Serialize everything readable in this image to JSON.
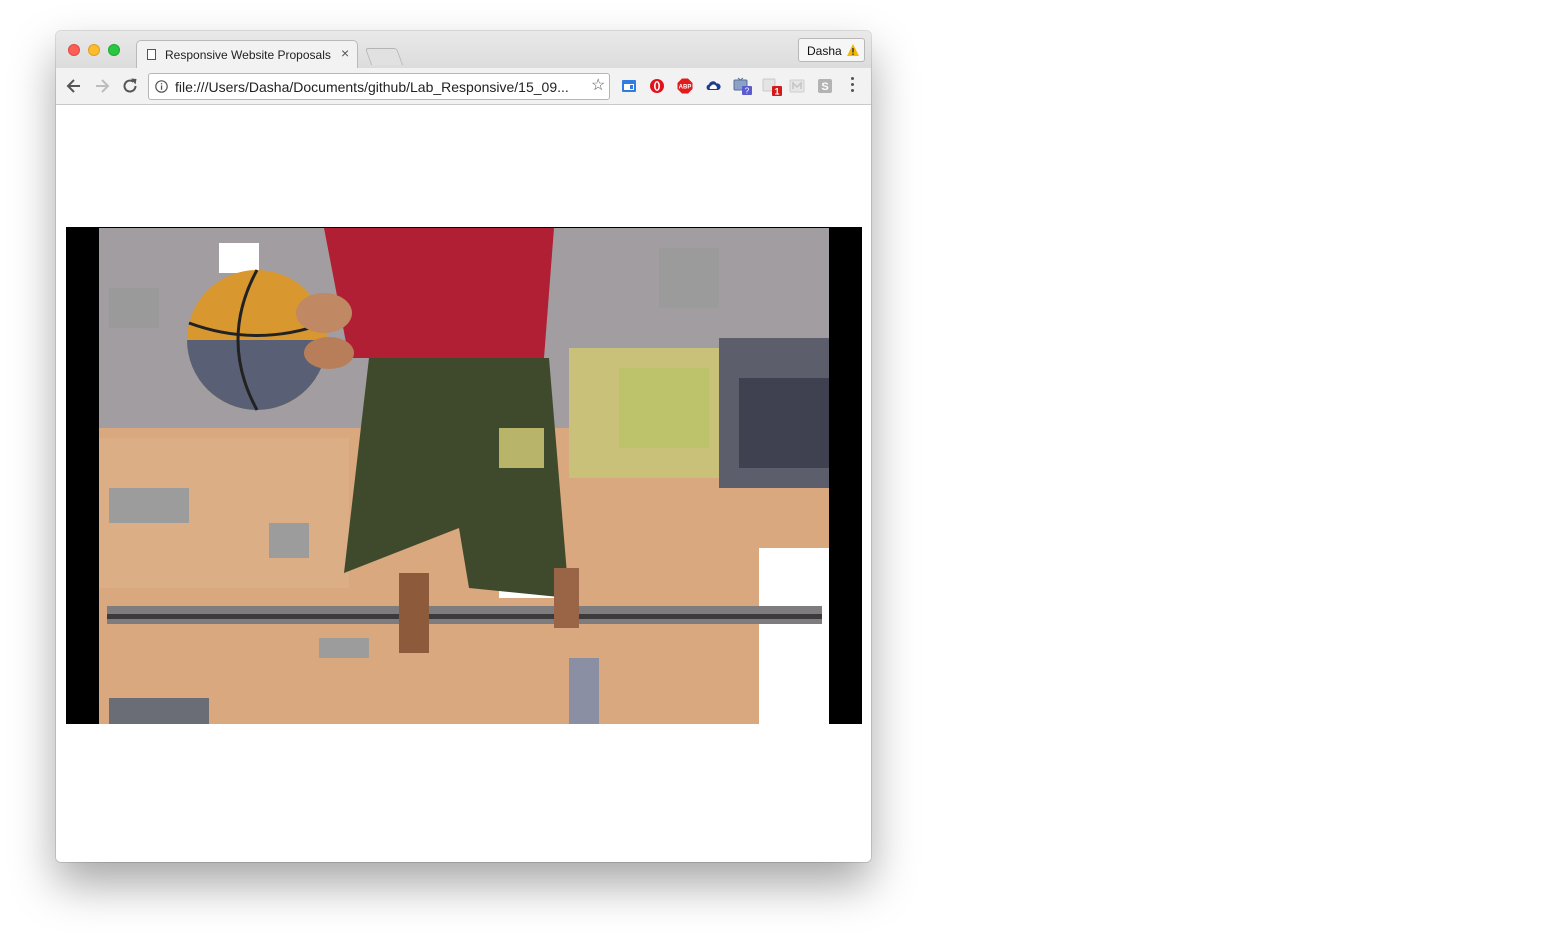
{
  "browser": {
    "tab": {
      "title": "Responsive Website Proposals",
      "close_glyph": "×"
    },
    "profile": {
      "name": "Dasha",
      "warning_icon": "warning-icon"
    },
    "address_bar": {
      "url": "file:///Users/Dasha/Documents/github/Lab_Responsive/15_09...",
      "info_icon": "info-icon",
      "bookmark_icon": "star-icon"
    },
    "nav": {
      "back_icon": "back-arrow-icon",
      "forward_icon": "forward-arrow-icon",
      "reload_icon": "reload-icon"
    },
    "extensions": [
      {
        "name": "window-extension-icon"
      },
      {
        "name": "opera-extension-icon"
      },
      {
        "name": "adblock-extension-icon",
        "label": "ABP"
      },
      {
        "name": "cloud-extension-icon"
      },
      {
        "name": "tv-extension-icon",
        "badge": "?"
      },
      {
        "name": "gift-extension-icon",
        "badge": "1"
      },
      {
        "name": "m-extension-icon"
      },
      {
        "name": "s-extension-icon",
        "label": "S"
      }
    ]
  },
  "page": {
    "video": {
      "description_icon": "video-frame-basketball"
    }
  },
  "colors": {
    "abp_red": "#e21b1b",
    "badge_blue": "#5b5bd1",
    "badge_red": "#d21a1a"
  }
}
